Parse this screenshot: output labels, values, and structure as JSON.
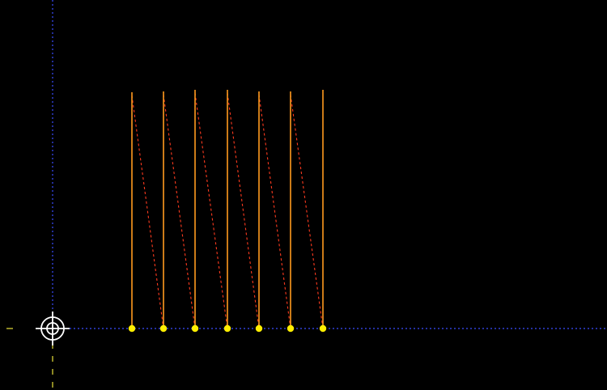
{
  "viewport": {
    "background_color": "#000000",
    "grid_axis_color": "#3a4dff",
    "origin_tick_color": "#e8e23a"
  },
  "origin_marker": {
    "icon": "crosshair-target-icon",
    "color": "#ffffff"
  },
  "toolpath": {
    "cut_color": "#ff9a1f",
    "rapid_color": "#ff3b1f",
    "point_color": "#ffee00",
    "pass_count": 7
  }
}
